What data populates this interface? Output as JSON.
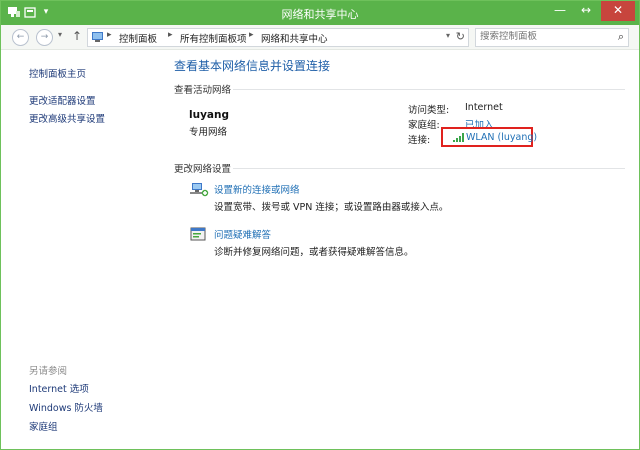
{
  "window": {
    "title": "网络和共享中心"
  },
  "addressbar": {
    "crumbs": [
      "控制面板",
      "所有控制面板项",
      "网络和共享中心"
    ],
    "search_placeholder": "搜索控制面板"
  },
  "sidebar": {
    "items": [
      {
        "label": "控制面板主页"
      },
      {
        "label": "更改适配器设置"
      },
      {
        "label": "更改高级共享设置"
      }
    ],
    "see_also_title": "另请参阅",
    "see_also": [
      {
        "label": "Internet 选项"
      },
      {
        "label": "Windows 防火墙"
      },
      {
        "label": "家庭组"
      }
    ]
  },
  "main": {
    "heading": "查看基本网络信息并设置连接",
    "active_section": "查看活动网络",
    "network": {
      "name": "luyang",
      "type": "专用网络",
      "access_type_label": "访问类型:",
      "access_type_value": "Internet",
      "homegroup_label": "家庭组:",
      "homegroup_value": "已加入",
      "connection_label": "连接:",
      "connection_value": "WLAN (luyang)"
    },
    "settings_section": "更改网络设置",
    "tasks": [
      {
        "title": "设置新的连接或网络",
        "desc": "设置宽带、拨号或 VPN 连接；或设置路由器或接入点。"
      },
      {
        "title": "问题疑难解答",
        "desc": "诊断并修复网络问题，或者获得疑难解答信息。"
      }
    ]
  },
  "colors": {
    "titlebar": "#5ab34a",
    "close_button": "#c7453d",
    "heading": "#1f5fa8",
    "link": "#1f6fb5",
    "highlight_box": "#e0221e"
  }
}
